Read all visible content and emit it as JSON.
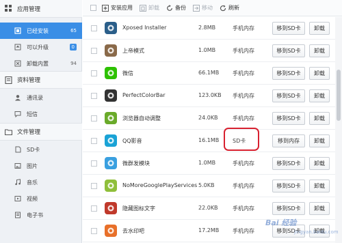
{
  "sidebar": {
    "sections": [
      {
        "title": "应用管理",
        "icon": "app-grid-icon",
        "items": [
          {
            "label": "已经安装",
            "count": "65",
            "icon": "installed-icon",
            "active": true
          },
          {
            "label": "可以升级",
            "count": "0",
            "icon": "upgrade-icon",
            "badge": true
          },
          {
            "label": "卸载内置",
            "count": "94",
            "icon": "uninstall-builtin-icon"
          }
        ]
      },
      {
        "title": "资料管理",
        "icon": "data-icon",
        "items": [
          {
            "label": "通讯录",
            "icon": "contacts-icon"
          },
          {
            "label": "短信",
            "icon": "sms-icon"
          }
        ]
      },
      {
        "title": "文件管理",
        "icon": "folder-icon",
        "items": [
          {
            "label": "SD卡",
            "icon": "sdcard-icon"
          },
          {
            "label": "图片",
            "icon": "image-icon"
          },
          {
            "label": "音乐",
            "icon": "music-icon"
          },
          {
            "label": "视频",
            "icon": "video-icon"
          },
          {
            "label": "电子书",
            "icon": "ebook-icon"
          }
        ]
      }
    ]
  },
  "toolbar": {
    "install": "安装应用",
    "uninstall": "卸载",
    "backup": "备份",
    "move": "移动",
    "refresh": "刷新"
  },
  "apps": [
    {
      "name": "Xposed Installer",
      "size": "2.8MB",
      "location": "手机内存",
      "action": "移到SD卡",
      "uninstall": "卸载",
      "icon": "xposed-icon",
      "color": "#2b5f8a"
    },
    {
      "name": "上帝模式",
      "size": "1.0MB",
      "location": "手机内存",
      "action": "移到SD卡",
      "uninstall": "卸载",
      "icon": "god-mode-icon",
      "color": "#8a6a4a"
    },
    {
      "name": "微信",
      "size": "66.1MB",
      "location": "手机内存",
      "action": "移到SD卡",
      "uninstall": "卸载",
      "icon": "wechat-icon",
      "color": "#2dc100"
    },
    {
      "name": "PerfectColorBar",
      "size": "123.0KB",
      "location": "手机内存",
      "action": "移到SD卡",
      "uninstall": "卸载",
      "icon": "colorbar-icon",
      "color": "#333333"
    },
    {
      "name": "浏览器自动调整",
      "size": "24.0KB",
      "location": "手机内存",
      "action": "移到SD卡",
      "uninstall": "卸载",
      "icon": "browser-adjust-icon",
      "color": "#6aaa2a"
    },
    {
      "name": "QQ影音",
      "size": "16.1MB",
      "location": "SD卡",
      "action": "移到内存",
      "uninstall": "卸载",
      "icon": "qq-player-icon",
      "color": "#1aa3d6"
    },
    {
      "name": "微群发模块",
      "size": "1.0MB",
      "location": "手机内存",
      "action": "移到SD卡",
      "uninstall": "卸载",
      "icon": "mass-send-icon",
      "color": "#3aa0e0"
    },
    {
      "name": "NoMoreGooglePlayServices",
      "size": "5.0KB",
      "location": "手机内存",
      "action": "移到SD卡",
      "uninstall": "卸载",
      "icon": "android-icon",
      "color": "#8fbf3a"
    },
    {
      "name": "隐藏图标文字",
      "size": "22.0KB",
      "location": "手机内存",
      "action": "移到SD卡",
      "uninstall": "卸载",
      "icon": "hide-label-icon",
      "color": "#c0392b"
    },
    {
      "name": "去水印吧",
      "size": "17.2MB",
      "location": "手机内存",
      "action": "移到SD卡",
      "uninstall": "卸载",
      "icon": "watermark-remove-icon",
      "color": "#e8702a"
    }
  ],
  "watermark": {
    "main": "Bai 经验",
    "sub": "jingyan.baidu.com"
  }
}
